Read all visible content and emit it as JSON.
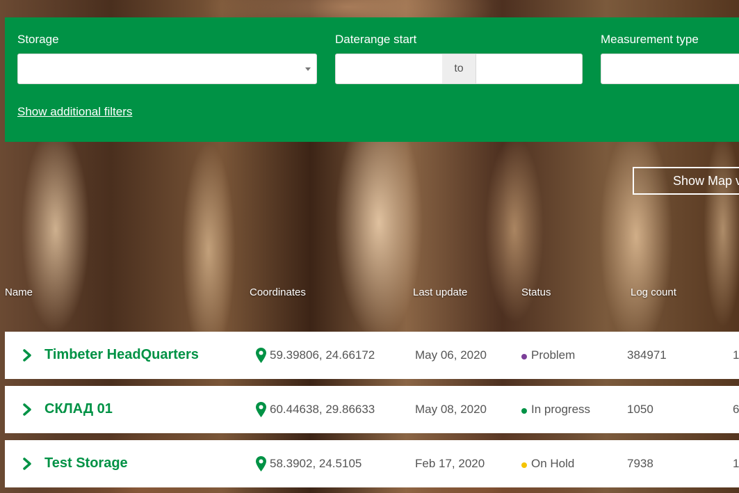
{
  "filters": {
    "storage_label": "Storage",
    "storage_value": "",
    "daterange_label": "Daterange start",
    "date_start_value": "",
    "date_separator": "to",
    "date_end_value": "",
    "measurement_label": "Measurement type",
    "measurement_value": "",
    "more_filters_link": "Show additional filters"
  },
  "map_button": "Show Map vi",
  "table": {
    "headers": [
      "Name",
      "Coordinates",
      "Last update",
      "Status",
      "Log count"
    ],
    "rows": [
      {
        "name": "Timbeter HeadQuarters",
        "coords": "59.39806, 24.66172",
        "date": "May 06, 2020",
        "status": "Problem",
        "status_color": "#7b3f98",
        "count": "384971",
        "extra": "1"
      },
      {
        "name": "СКЛАД 01",
        "coords": "60.44638, 29.86633",
        "date": "May 08, 2020",
        "status": "In progress",
        "status_color": "#009245",
        "count": "1050",
        "extra": "6"
      },
      {
        "name": "Test Storage",
        "coords": "58.3902, 24.5105",
        "date": "Feb 17, 2020",
        "status": "On Hold",
        "status_color": "#f5c400",
        "count": "7938",
        "extra": "1"
      }
    ]
  },
  "colors": {
    "brand_green": "#009245",
    "text_gray": "#555555"
  },
  "icons": {
    "expand": "chevron-right-icon",
    "location": "map-pin-icon",
    "dropdown": "caret-down-icon"
  }
}
